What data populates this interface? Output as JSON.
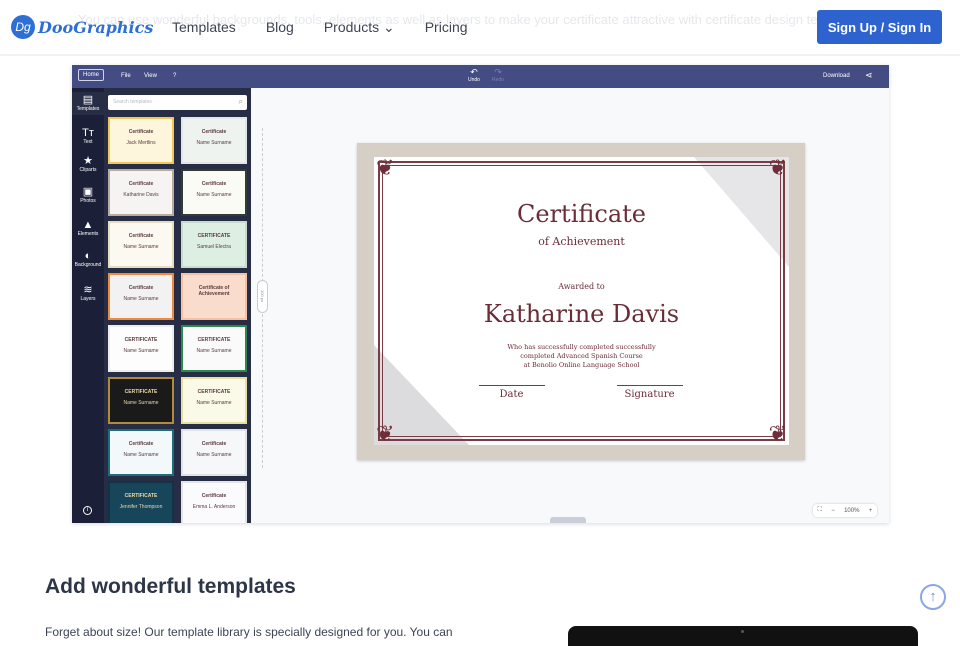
{
  "header": {
    "ghost_text": "You can use wonderful backgrounds, tools, elements as well as layers to make your certificate attractive with certificate design templates",
    "logo": "DooGraphics",
    "logo_mark": "Dg",
    "nav": [
      "Templates",
      "Blog",
      "Products",
      "Pricing"
    ],
    "products_caret": "⌄",
    "signin": "Sign Up / Sign In"
  },
  "editor": {
    "menu": {
      "home": "Home",
      "file": "File",
      "view": "View",
      "help": "?",
      "undo": "Undo",
      "redo": "Redo",
      "download": "Download"
    },
    "rail": [
      {
        "label": "Templates",
        "icon": "▤"
      },
      {
        "label": "Text",
        "icon": "Tт"
      },
      {
        "label": "Cliparts",
        "icon": "★"
      },
      {
        "label": "Photos",
        "icon": "▣"
      },
      {
        "label": "Elements",
        "icon": "▲"
      },
      {
        "label": "Background",
        "icon": "◐"
      },
      {
        "label": "Layers",
        "icon": "≋"
      }
    ],
    "search_placeholder": "Search templates",
    "templates": [
      {
        "title": "Certificate",
        "name": "Jack Mertlins",
        "bg": "#fdf6dc",
        "border": "#f0c75a"
      },
      {
        "title": "Certificate",
        "name": "Name Surname",
        "bg": "#eef3f0",
        "border": "#e1e6ea"
      },
      {
        "title": "Certificate",
        "name": "Katharine Davis",
        "bg": "#f6f4f2",
        "border": "#b9aba0"
      },
      {
        "title": "Certificate",
        "name": "Name Surname",
        "bg": "#fbfbf6",
        "border": "#2f3d33"
      },
      {
        "title": "Certificate",
        "name": "Name Surname",
        "bg": "#fbf9f0",
        "border": "#e6dcc1"
      },
      {
        "title": "CERTIFICATE",
        "name": "Samuel Electra",
        "bg": "#dcefe2",
        "border": "#c8dcce"
      },
      {
        "title": "Certificate",
        "name": "Name Surname",
        "bg": "#f2f2f2",
        "border": "#f08a3c"
      },
      {
        "title": "Certificate of Achievement",
        "name": "",
        "bg": "#f9dccb",
        "border": "#f4c1a6"
      },
      {
        "title": "CERTIFICATE",
        "name": "Name Surname",
        "bg": "#fdfdfd",
        "border": "#ececec"
      },
      {
        "title": "CERTIFICATE",
        "name": "Name Surname",
        "bg": "#fafafa",
        "border": "#2b8a4e"
      },
      {
        "title": "CERTIFICATE",
        "name": "Name Surname",
        "bg": "#1a1a1a",
        "border": "#b18a3b"
      },
      {
        "title": "CERTIFICATE",
        "name": "Name Surname",
        "bg": "#fbfae9",
        "border": "#e5dfa3"
      },
      {
        "title": "Certificate",
        "name": "Name Surname",
        "bg": "#f3f8fa",
        "border": "#1f6d7a"
      },
      {
        "title": "Certificate",
        "name": "Name Surname",
        "bg": "#f6f7f9",
        "border": "#dfe2e7"
      },
      {
        "title": "CERTIFICATE",
        "name": "Jennifer Thompson",
        "bg": "#17465a",
        "border": "#0f3445"
      },
      {
        "title": "Certificate",
        "name": "Emma L. Anderson",
        "bg": "#fbfbfd",
        "border": "#e2e4ea"
      }
    ],
    "ruler_label": "100 px",
    "certificate": {
      "title": "Certificate",
      "subtitle": "of Achievement",
      "awarded": "Awarded to",
      "name": "Katharine Davis",
      "body": [
        "Who has successfully completed successfully",
        "completed Advanced Spanish Course",
        "at Benolio Online Language School"
      ],
      "date": "Date",
      "signature": "Signature"
    },
    "zoom": "100%"
  },
  "section": {
    "heading": "Add wonderful templates",
    "paragraph": "Forget about size! Our template library is specially designed for you. You can"
  }
}
